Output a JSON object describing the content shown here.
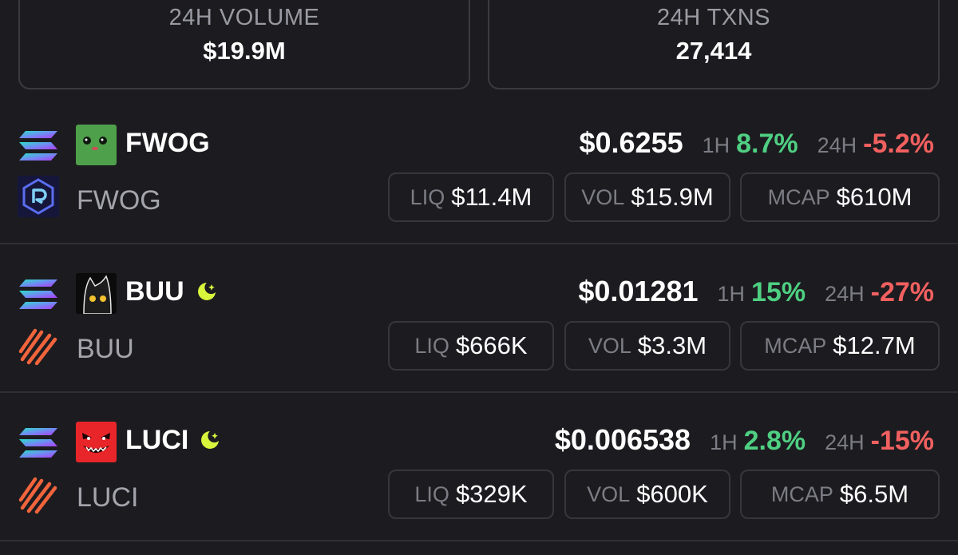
{
  "stats": {
    "volume": {
      "label": "24H VOLUME",
      "value": "$19.9M"
    },
    "txns": {
      "label": "24H TXNS",
      "value": "27,414"
    }
  },
  "colors": {
    "background": "#1c1c20",
    "positive": "#4fcf82",
    "negative": "#f2605f",
    "muted": "#7c7c85",
    "boost": "#d9f53c"
  },
  "tokens": [
    {
      "symbol": "FWOG",
      "name": "FWOG",
      "chain_icon": "solana-icon",
      "dex_icon": "raydium-icon",
      "avatar_icon": "fwog-avatar",
      "boosted": false,
      "price": "$0.6255",
      "h1_label": "1H",
      "h1_change": "8.7%",
      "h24_label": "24H",
      "h24_change": "-5.2%",
      "liq_label": "LIQ",
      "liq": "$11.4M",
      "vol_label": "VOL",
      "vol": "$15.9M",
      "mcap_label": "MCAP",
      "mcap": "$610M"
    },
    {
      "symbol": "BUU",
      "name": "BUU",
      "chain_icon": "solana-icon",
      "dex_icon": "moonshot-icon",
      "avatar_icon": "buu-avatar",
      "boosted": true,
      "price": "$0.01281",
      "h1_label": "1H",
      "h1_change": "15%",
      "h24_label": "24H",
      "h24_change": "-27%",
      "liq_label": "LIQ",
      "liq": "$666K",
      "vol_label": "VOL",
      "vol": "$3.3M",
      "mcap_label": "MCAP",
      "mcap": "$12.7M"
    },
    {
      "symbol": "LUCI",
      "name": "LUCI",
      "chain_icon": "solana-icon",
      "dex_icon": "moonshot-icon",
      "avatar_icon": "luci-avatar",
      "boosted": true,
      "price": "$0.006538",
      "h1_label": "1H",
      "h1_change": "2.8%",
      "h24_label": "24H",
      "h24_change": "-15%",
      "liq_label": "LIQ",
      "liq": "$329K",
      "vol_label": "VOL",
      "vol": "$600K",
      "mcap_label": "MCAP",
      "mcap": "$6.5M"
    }
  ]
}
